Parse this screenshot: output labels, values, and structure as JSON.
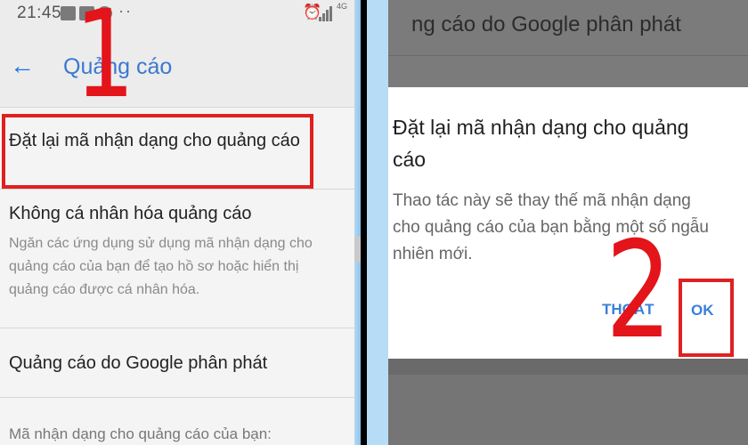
{
  "status_bar": {
    "time": "21:45",
    "network": "4G"
  },
  "settings_screen": {
    "title": "Quảng cáo",
    "items": [
      {
        "title": "Đặt lại mã nhận dạng cho quảng cáo"
      },
      {
        "title": "Không cá nhân hóa quảng cáo",
        "description": "Ngăn các ứng dụng sử dụng mã nhận dạng cho quảng cáo của bạn để tạo hồ sơ hoặc hiển thị quảng cáo được cá nhân hóa."
      },
      {
        "title": "Quảng cáo do Google phân phát"
      },
      {
        "title": "Mã nhận dạng cho quảng cáo của bạn:"
      }
    ]
  },
  "dialog_screen": {
    "background_header": "ng cáo do Google phân phát",
    "title": "Đặt lại mã nhận dạng cho quảng cáo",
    "body": "Thao tác này sẽ thay thế mã nhận dạng cho quảng cáo của bạn bằng một số ngẫu nhiên mới.",
    "cancel_label": "THOÁT",
    "ok_label": "OK"
  },
  "annotations": {
    "step1": "1",
    "step2": "2",
    "highlight_color": "#e02020"
  },
  "icons": [
    "back-arrow-icon",
    "alarm-icon",
    "signal-icon"
  ]
}
